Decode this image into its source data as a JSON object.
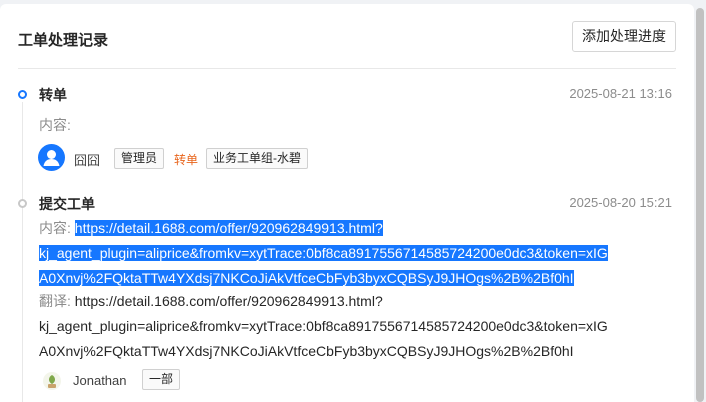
{
  "header": {
    "title": "工单处理记录",
    "add_button": "添加处理进度"
  },
  "entries": [
    {
      "action": "转单",
      "time": "2025-08-21 13:16",
      "content_label": "内容:",
      "operator": "囧囧",
      "role_tag": "管理员",
      "verb": "转单",
      "target_tag": "业务工单组-水碧"
    },
    {
      "action": "提交工单",
      "time": "2025-08-20 15:21",
      "content_label": "内容:",
      "content_line1": "https://detail.1688.com/offer/920962849913.html?",
      "content_line2": "kj_agent_plugin=aliprice&fromkv=xytTrace:0bf8ca8917556714585724200e0dc3&token=xIG",
      "content_line3": "A0Xnvj%2FQktaTTw4YXdsj7NKCoJiAkVtfceCbFyb3byxCQBSyJ9JHOgs%2B%2Bf0hI",
      "translation_label": "翻译:",
      "translation_line1": "https://detail.1688.com/offer/920962849913.html?",
      "translation_line2": "kj_agent_plugin=aliprice&fromkv=xytTrace:0bf8ca8917556714585724200e0dc3&token=xIG",
      "translation_line3": "A0Xnvj%2FQktaTTw4YXdsj7NKCoJiAkVtfceCbFyb3byxCQBSyJ9JHOgs%2B%2Bf0hI",
      "operator": "Jonathan",
      "dept_tag": "一部"
    }
  ],
  "colors": {
    "accent": "#1677ff",
    "action_orange": "#e8651c",
    "selection": "#1677ff"
  },
  "icons": {
    "avatar_1": "user-avatar-icon",
    "avatar_2": "leaf-avatar-icon"
  }
}
